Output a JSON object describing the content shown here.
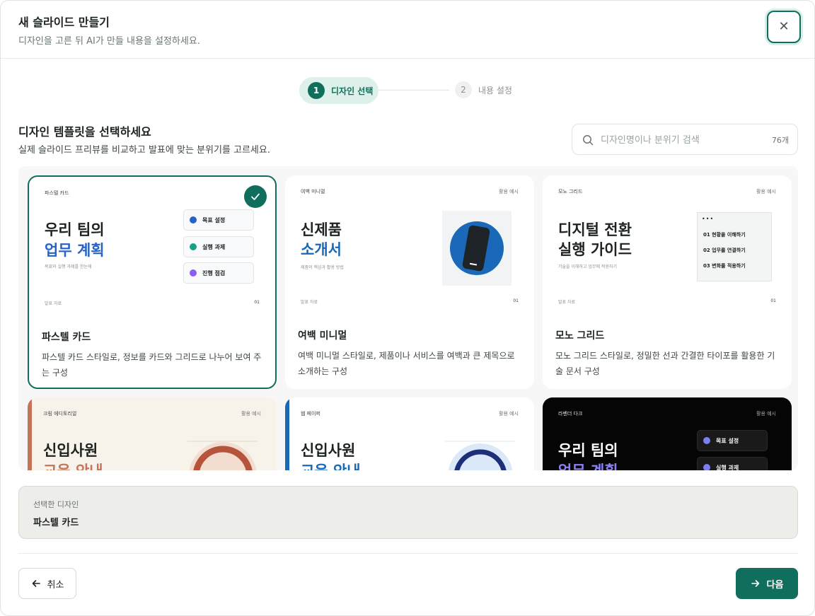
{
  "header": {
    "title": "새 슬라이드 만들기",
    "subtitle": "디자인을 고른 뒤 AI가 만들 내용을 설정하세요.",
    "close_icon": "close-icon"
  },
  "stepper": {
    "steps": [
      {
        "num": "1",
        "label": "디자인 선택",
        "active": true
      },
      {
        "num": "2",
        "label": "내용 설정",
        "active": false
      }
    ]
  },
  "section": {
    "title": "디자인 템플릿을 선택하세요",
    "subtitle": "실제 슬라이드 프리뷰를 비교하고 발표에 맞는 분위기를 고르세요."
  },
  "search": {
    "placeholder": "디자인명이나 분위기 검색",
    "count": "76개"
  },
  "templates": [
    {
      "name": "파스텔 카드",
      "desc": "파스텔 카드 스타일로, 정보를 카드와 그리드로 나누어 보여 주는 구성",
      "selected": true,
      "preview": {
        "tag": "파스텔 카드",
        "title1": "우리 팀의",
        "title2": "업무 계획",
        "small": "목표와 실행 과제를 한눈에",
        "foot": "발표 자료",
        "page": "01",
        "items": [
          "목표 설정",
          "실행 과제",
          "진행 점검"
        ]
      }
    },
    {
      "name": "여백 미니멀",
      "desc": "여백 미니멀 스타일로, 제품이나 서비스를 여백과 큰 제목으로 소개하는 구성",
      "selected": false,
      "preview": {
        "tag": "여백 미니멀",
        "use": "활용 예시",
        "title1": "신제품",
        "title2": "소개서",
        "small": "제품의 핵심과 활용 방법",
        "foot": "발표 자료",
        "page": "01"
      }
    },
    {
      "name": "모노 그리드",
      "desc": "모노 그리드 스타일로, 정밀한 선과 간결한 타이포를 활용한 기술 문서 구성",
      "selected": false,
      "preview": {
        "tag": "모노 그리드",
        "use": "활용 예시",
        "title1": "디지털 전환",
        "title2": "실행 가이드",
        "small": "기술을 이해하고 업무에 적용하기",
        "foot": "발표 자료",
        "page": "01",
        "items": [
          "01 현황을 이해하기",
          "02 업무를 연결하기",
          "03 변화를 적용하기"
        ]
      }
    },
    {
      "preview": {
        "tag": "크림 에디토리얼",
        "use": "활용 예시",
        "title1": "신입사원",
        "title2": "교육 안내"
      }
    },
    {
      "preview": {
        "tag": "웹 페이퍼",
        "use": "활용 예시",
        "title1": "신입사원",
        "title2": "교육 안내"
      }
    },
    {
      "preview": {
        "tag": "라벤더 다크",
        "use": "활용 예시",
        "title1": "우리 팀의",
        "title2": "업무 계획",
        "items": [
          "목표 설정",
          "실행 과제"
        ]
      }
    }
  ],
  "selected": {
    "label": "선택한 디자인",
    "value": "파스텔 카드"
  },
  "footer": {
    "cancel": "취소",
    "next": "다음"
  },
  "colors": {
    "accent": "#0f6e5c",
    "accent_light": "#ddf1ea",
    "blue": "#2563c9",
    "dark_card": "#050505"
  }
}
